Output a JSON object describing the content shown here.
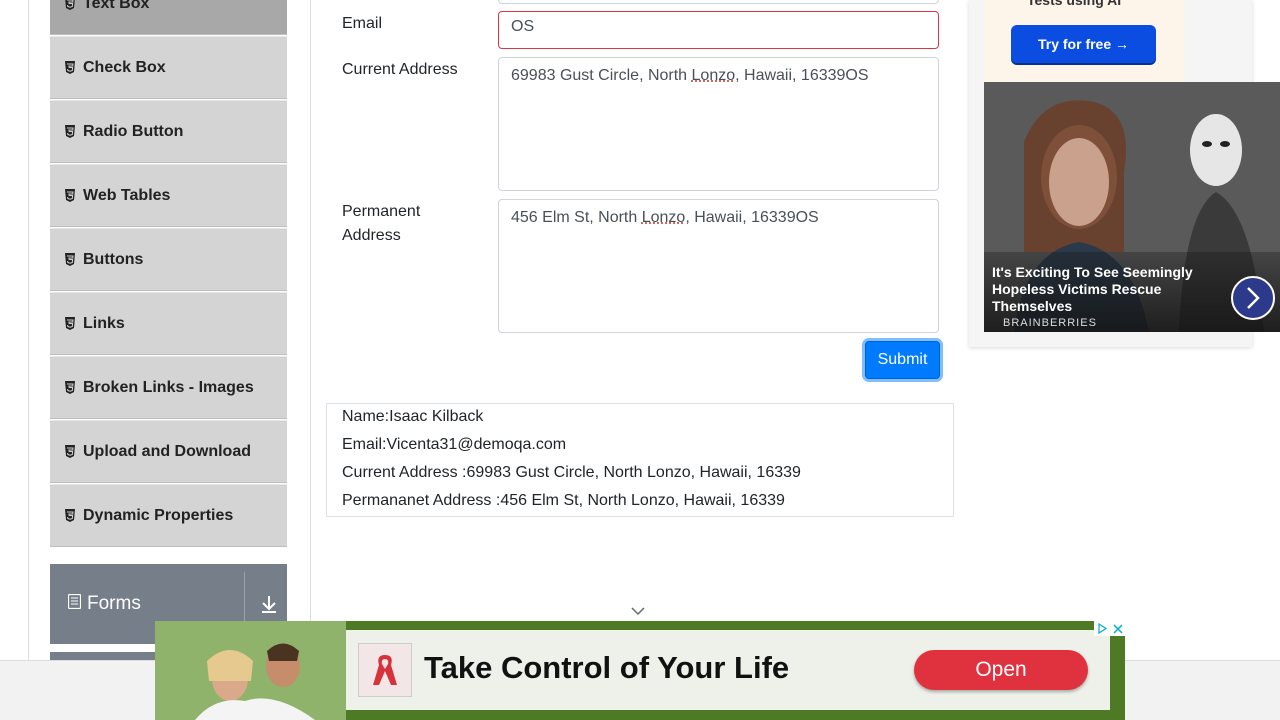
{
  "sidebar": {
    "items": [
      {
        "label": "Text Box"
      },
      {
        "label": "Check Box"
      },
      {
        "label": "Radio Button"
      },
      {
        "label": "Web Tables"
      },
      {
        "label": "Buttons"
      },
      {
        "label": "Links"
      },
      {
        "label": "Broken Links - Images"
      },
      {
        "label": "Upload and Download"
      },
      {
        "label": "Dynamic Properties"
      }
    ],
    "group": {
      "label": "Forms"
    }
  },
  "form": {
    "email_label": "Email",
    "email_value": "OS",
    "current_address_label": "Current Address",
    "current_address_value": {
      "pre": "69983 Gust Circle, North ",
      "mark": "Lonzo",
      "post": ", Hawaii, 16339OS"
    },
    "permanent_address_label_1": "Permanent",
    "permanent_address_label_2": "Address",
    "permanent_address_value": {
      "pre": "456 Elm St, North ",
      "mark": "Lonzo",
      "post": ", Hawaii, 16339OS"
    },
    "submit_label": "Submit"
  },
  "output": {
    "name": "Name:Isaac Kilback",
    "email": "Email:Vicenta31@demoqa.com",
    "current_address": "Current Address :69983 Gust Circle, North Lonzo, Hawaii, 16339",
    "permanent_address": "Permananet Address :456 Elm St, North Lonzo, Hawaii, 16339"
  },
  "right_ad": {
    "top_text": "Tests using AI",
    "button": "Try for free →",
    "caption": "It's Exciting To See Seemingly Hopeless Victims Rescue Themselves",
    "source": "BRAINBERRIES"
  },
  "bottom_ad": {
    "title": "Take Control of Your Life",
    "button": "Open"
  },
  "colors": {
    "submit": "#007bff",
    "error_border": "#dc3545",
    "group_header": "#767e8a",
    "open_button": "#e0313f"
  }
}
